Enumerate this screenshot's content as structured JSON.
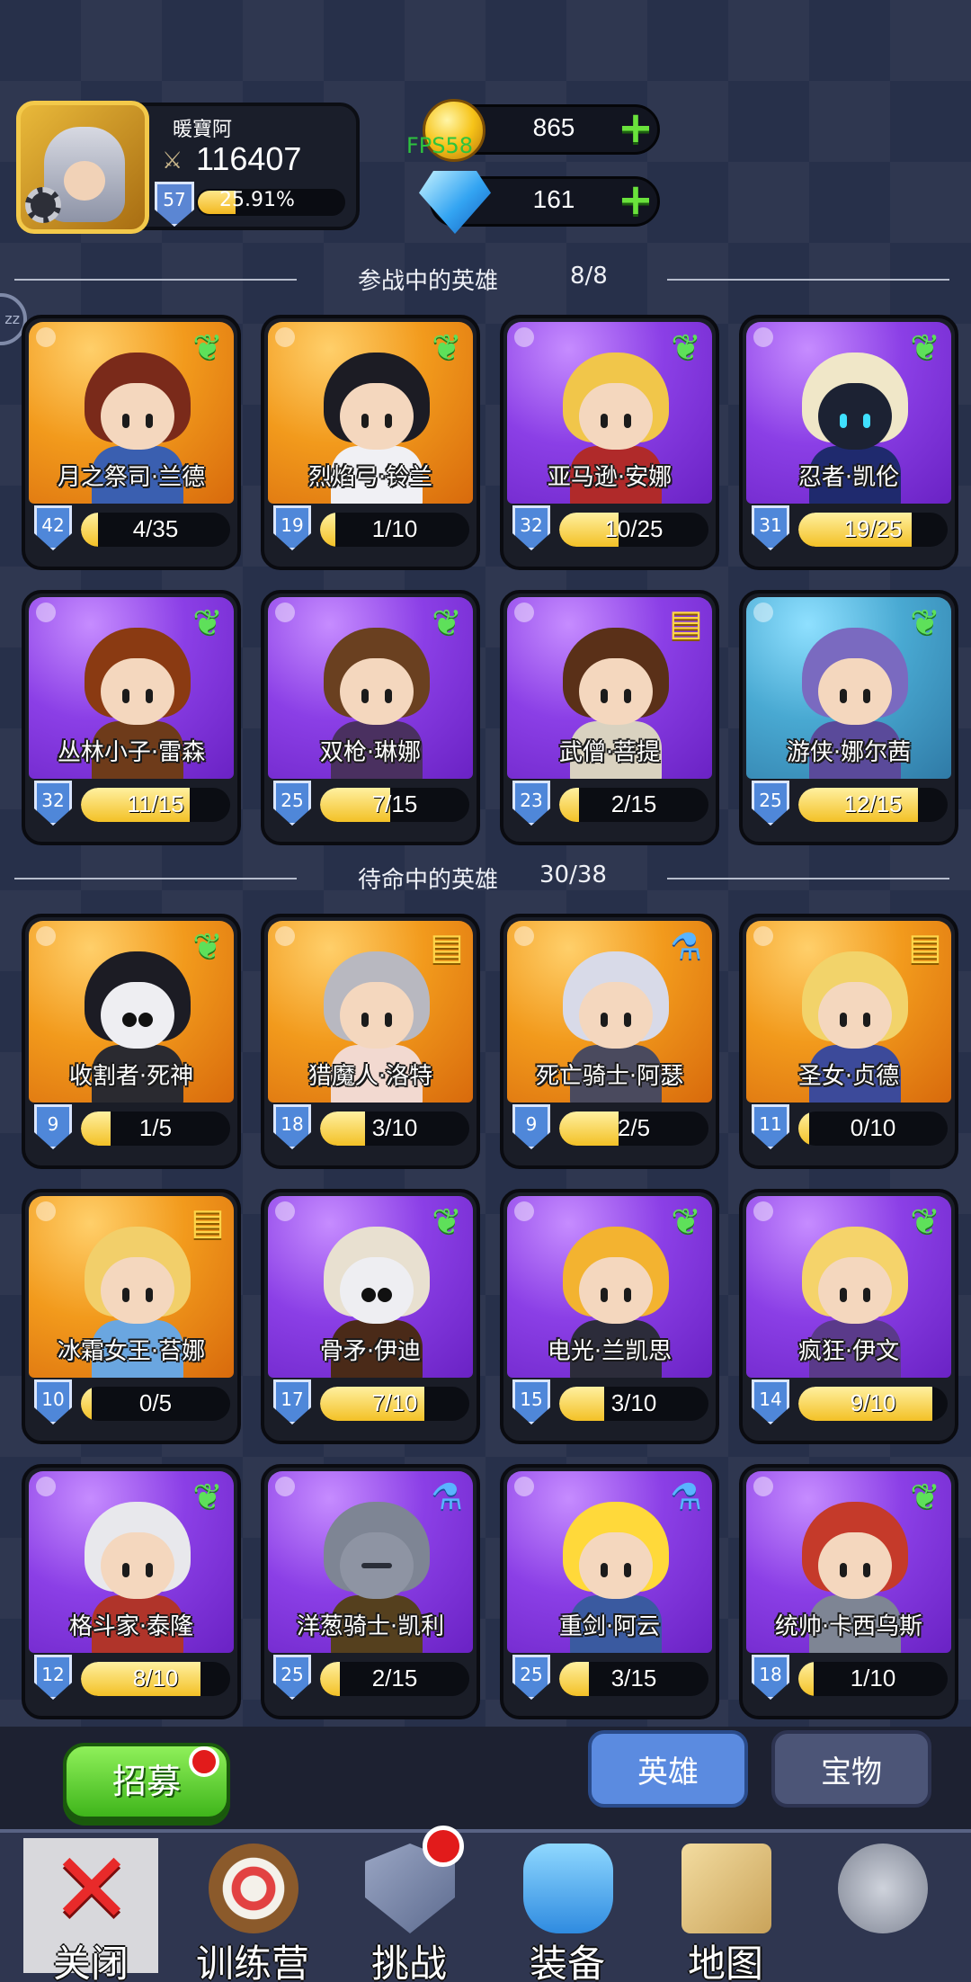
{
  "player": {
    "name": "暖寶阿",
    "power": "116407",
    "level": "57",
    "exp_percent_text": "25.91%",
    "exp_fraction": 0.2591
  },
  "resources": {
    "gold": "865",
    "gems": "161",
    "fps": "FPS58"
  },
  "side_button_label": "zz",
  "active_section": {
    "title": "参战中的英雄",
    "count": "8/8"
  },
  "reserve_section": {
    "title": "待命中的英雄",
    "count": "30/38"
  },
  "active_heroes": [
    {
      "name": "月之祭司·兰德",
      "level": "42",
      "progress": "4/35",
      "ratio": 0.114,
      "bg": "orange",
      "badge": "leaf"
    },
    {
      "name": "烈焰弓·铃兰",
      "level": "19",
      "progress": "1/10",
      "ratio": 0.1,
      "bg": "orange",
      "badge": "leaf"
    },
    {
      "name": "亚马逊·安娜",
      "level": "32",
      "progress": "10/25",
      "ratio": 0.4,
      "bg": "purple",
      "badge": "leaf"
    },
    {
      "name": "忍者·凯伦",
      "level": "31",
      "progress": "19/25",
      "ratio": 0.76,
      "bg": "purple",
      "badge": "leaf"
    },
    {
      "name": "丛林小子·雷森",
      "level": "32",
      "progress": "11/15",
      "ratio": 0.73,
      "bg": "purple",
      "badge": "leaf"
    },
    {
      "name": "双枪·琳娜",
      "level": "25",
      "progress": "7/15",
      "ratio": 0.47,
      "bg": "purple",
      "badge": "leaf"
    },
    {
      "name": "武僧·菩提",
      "level": "23",
      "progress": "2/15",
      "ratio": 0.13,
      "bg": "purple",
      "badge": "book"
    },
    {
      "name": "游侠·娜尔茜",
      "level": "25",
      "progress": "12/15",
      "ratio": 0.8,
      "bg": "teal",
      "badge": "leaf"
    }
  ],
  "reserve_heroes": [
    {
      "name": "收割者·死神",
      "level": "9",
      "progress": "1/5",
      "ratio": 0.2,
      "bg": "orange",
      "badge": "leaf"
    },
    {
      "name": "猎魔人·洛特",
      "level": "18",
      "progress": "3/10",
      "ratio": 0.3,
      "bg": "orange",
      "badge": "book"
    },
    {
      "name": "死亡骑士·阿瑟",
      "level": "9",
      "progress": "2/5",
      "ratio": 0.4,
      "bg": "orange",
      "badge": "potion"
    },
    {
      "name": "圣女·贞德",
      "level": "11",
      "progress": "0/10",
      "ratio": 0,
      "bg": "orange",
      "badge": "book"
    },
    {
      "name": "冰霜女王·苔娜",
      "level": "10",
      "progress": "0/5",
      "ratio": 0,
      "bg": "orange",
      "badge": "book"
    },
    {
      "name": "骨矛·伊迪",
      "level": "17",
      "progress": "7/10",
      "ratio": 0.7,
      "bg": "purple",
      "badge": "leaf"
    },
    {
      "name": "电光·兰凯思",
      "level": "15",
      "progress": "3/10",
      "ratio": 0.3,
      "bg": "purple",
      "badge": "leaf"
    },
    {
      "name": "疯狂·伊文",
      "level": "14",
      "progress": "9/10",
      "ratio": 0.9,
      "bg": "purple",
      "badge": "leaf"
    },
    {
      "name": "格斗家·泰隆",
      "level": "12",
      "progress": "8/10",
      "ratio": 0.8,
      "bg": "purple",
      "badge": "leaf"
    },
    {
      "name": "洋葱骑士·凯利",
      "level": "25",
      "progress": "2/15",
      "ratio": 0.13,
      "bg": "purple",
      "badge": "potion"
    },
    {
      "name": "重剑·阿云",
      "level": "25",
      "progress": "3/15",
      "ratio": 0.2,
      "bg": "purple",
      "badge": "potion"
    },
    {
      "name": "统帅·卡西乌斯",
      "level": "18",
      "progress": "1/10",
      "ratio": 0.1,
      "bg": "purple",
      "badge": "leaf"
    }
  ],
  "recruit_label": "招募",
  "tabs": {
    "heroes": "英雄",
    "treasure": "宝物"
  },
  "nav": {
    "close": "关闭",
    "training": "训练营",
    "challenge": "挑战",
    "equipment": "装备",
    "map": "地图"
  },
  "colors": {
    "accent_blue": "#5b8be0",
    "progress_yellow": "#f3c126",
    "gold": "#f6c318",
    "green_plus": "#6ae23c",
    "alert_red": "#e21b1b"
  },
  "icons": {
    "leaf": "❦",
    "book": "▤",
    "potion": "⚗",
    "plus": "+",
    "close": "✕",
    "sword": "⚔",
    "gear": "⚙"
  }
}
